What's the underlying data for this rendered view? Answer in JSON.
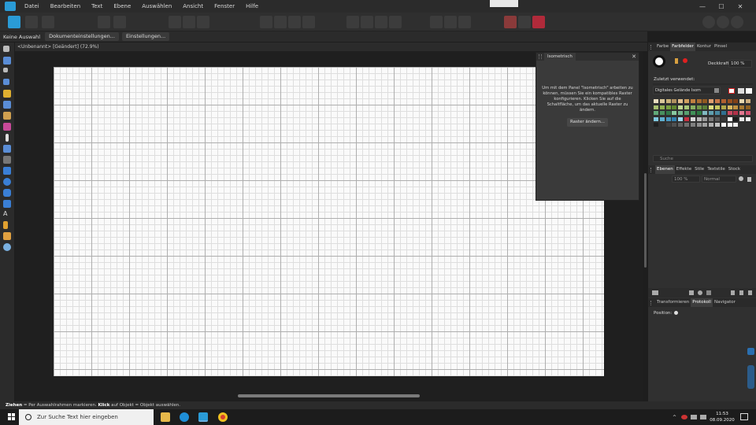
{
  "menubar": {
    "items": [
      "Datei",
      "Bearbeiten",
      "Text",
      "Ebene",
      "Auswählen",
      "Ansicht",
      "Fenster",
      "Hilfe"
    ],
    "window_controls": [
      "—",
      "☐",
      "✕"
    ]
  },
  "context_toolbar": {
    "selection_label": "Keine Auswahl",
    "doc_settings_button": "Dokumenteinstellungen...",
    "settings_button": "Einstellungen..."
  },
  "document": {
    "tab_title": "<Unbenannt> [Geändert] (72.9%)"
  },
  "isometric_panel": {
    "title": "Isometrisch",
    "close": "✕",
    "message": "Um mit dem Panel \"Isometrisch\" arbeiten zu können, müssen Sie ein kompatibles Raster konfigurieren. Klicken Sie auf die Schaltfläche, um das aktuelle Raster zu ändern.",
    "button": "Raster ändern..."
  },
  "right_panel": {
    "top_tabs": [
      "Farbe",
      "Farbfelder",
      "Kontur",
      "Pinsel"
    ],
    "active_top_tab": "Farbfelder",
    "opacity_label": "Deckkraft:",
    "opacity_value": "100 %",
    "recent_label": "Zuletzt verwendet:",
    "palette_name": "Digitales Gelände Isom",
    "search_placeholder": "Suche",
    "layer_tabs": [
      "Ebenen",
      "Effekte",
      "Stile",
      "Textstile",
      "Stock"
    ],
    "active_layer_tab": "Ebenen",
    "layer_opacity": "100 %",
    "blend_mode": "Normal",
    "bottom_tabs": [
      "Transformieren",
      "Protokoll",
      "Navigator"
    ],
    "active_bottom_tab": "Protokoll",
    "position_label": "Position:"
  },
  "status": {
    "drag_bold": "Ziehen",
    "drag_text": " = Per Auswahlrahmen markieren. ",
    "click_bold": "Klick",
    "click_text": " auf Objekt = Objekt auswählen."
  },
  "taskbar": {
    "search_placeholder": "Zur Suche Text hier eingeben",
    "time": "11:53",
    "date": "08.09.2020"
  },
  "colors": {
    "accent": "#2a9bd6",
    "canvas": "#fafafa",
    "panel_bg": "#303030"
  }
}
